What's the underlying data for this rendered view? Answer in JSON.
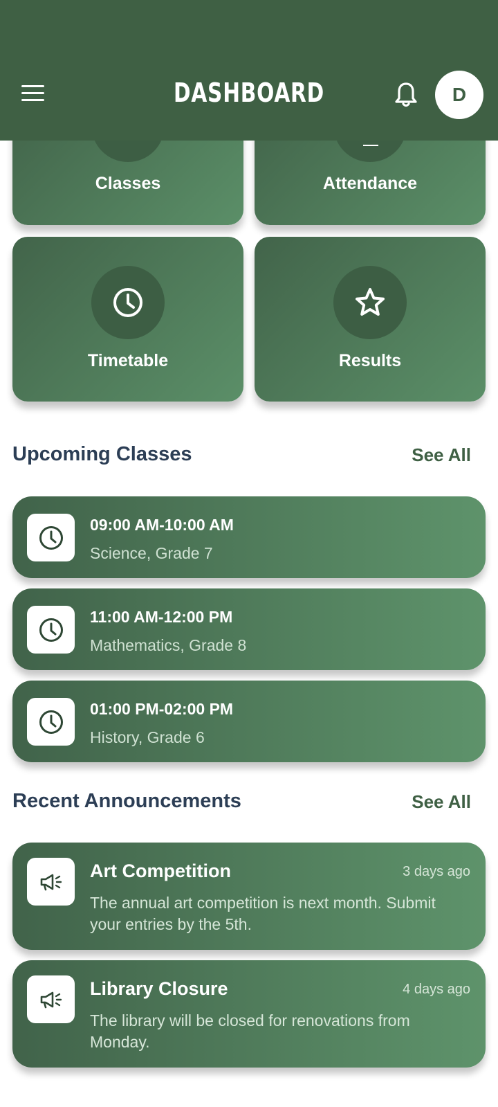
{
  "header": {
    "title": "DASHBOARD",
    "avatar_initial": "D"
  },
  "tiles": [
    {
      "label": "Classes",
      "icon": "book-icon"
    },
    {
      "label": "Attendance",
      "icon": "checklist-icon"
    },
    {
      "label": "Timetable",
      "icon": "clock-icon"
    },
    {
      "label": "Results",
      "icon": "star-icon"
    }
  ],
  "upcoming": {
    "title": "Upcoming Classes",
    "see_all": "See All",
    "items": [
      {
        "time": "09:00 AM-10:00 AM",
        "subject": "Science, Grade 7"
      },
      {
        "time": "11:00 AM-12:00 PM",
        "subject": "Mathematics, Grade 8"
      },
      {
        "time": "01:00 PM-02:00 PM",
        "subject": "History, Grade 6"
      }
    ]
  },
  "announcements": {
    "title": "Recent Announcements",
    "see_all": "See All",
    "items": [
      {
        "title": "Art Competition",
        "time": "3 days ago",
        "body": "The annual art competition is next month. Submit your entries by the 5th."
      },
      {
        "title": "Library Closure",
        "time": "4 days ago",
        "body": "The library will be closed for renovations from Monday."
      }
    ]
  }
}
